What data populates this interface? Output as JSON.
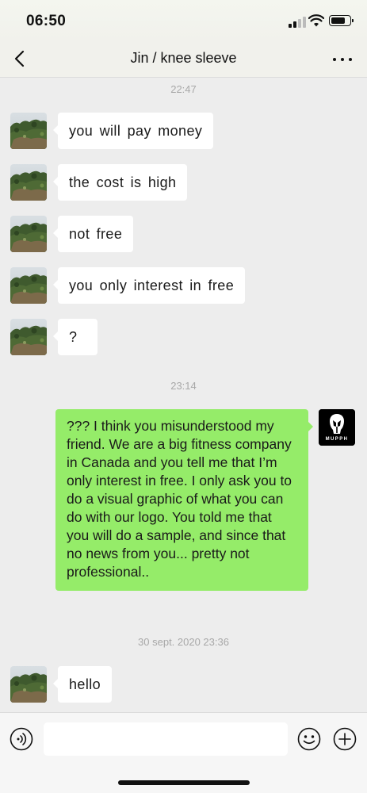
{
  "status_bar": {
    "time": "06:50",
    "battery_level": 0.75
  },
  "header": {
    "title": "Jin / knee sleeve",
    "back_icon": "chevron-left-icon",
    "more_icon": "more-dots-icon"
  },
  "chat": {
    "timestamps": [
      "22:47",
      "23:14",
      "30 sept. 2020 23:36"
    ],
    "messages": [
      {
        "sender": "contact",
        "text": "you  will  pay money"
      },
      {
        "sender": "contact",
        "text": "the  cost  is  high"
      },
      {
        "sender": "contact",
        "text": "not  free"
      },
      {
        "sender": "contact",
        "text": "you  only  interest  in  free"
      },
      {
        "sender": "contact",
        "text": "?"
      },
      {
        "sender": "me",
        "text": "??? I think you misunderstood my friend. We are a big fitness company in Canada and you tell me that I’m only interest in free. I only ask you to do a visual graphic of what you can do with our logo. You told me that you will do a sample, and since that no news from you... pretty not professional.."
      },
      {
        "sender": "contact",
        "text": "hello"
      }
    ],
    "my_avatar_logo": "MUPPH"
  },
  "input_bar": {
    "value": "",
    "placeholder": "",
    "voice_icon": "voice-icon",
    "emoji_icon": "emoji-icon",
    "plus_icon": "plus-icon"
  },
  "colors": {
    "my_bubble": "#95ec69",
    "their_bubble": "#ffffff",
    "background": "#ededed"
  }
}
